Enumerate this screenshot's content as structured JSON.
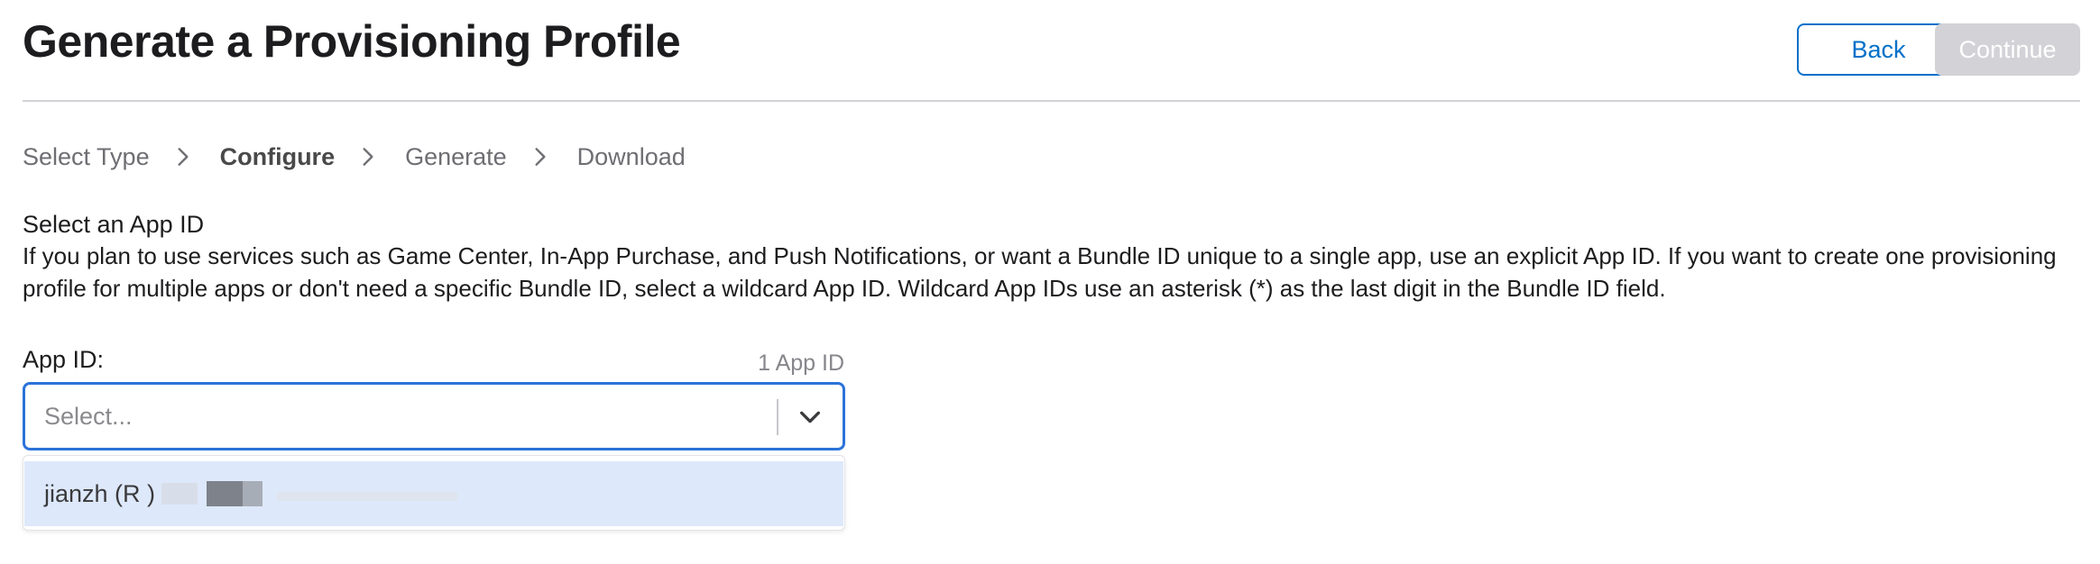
{
  "header": {
    "title": "Generate a Provisioning Profile",
    "back_label": "Back",
    "continue_label": "Continue"
  },
  "breadcrumb": {
    "steps": [
      {
        "label": "Select Type",
        "current": false
      },
      {
        "label": "Configure",
        "current": true
      },
      {
        "label": "Generate",
        "current": false
      },
      {
        "label": "Download",
        "current": false
      }
    ]
  },
  "section": {
    "title": "Select an App ID",
    "description": "If you plan to use services such as Game Center, In-App Purchase, and Push Notifications, or want a Bundle ID unique to a single app, use an explicit App ID. If you want to create one provisioning profile for multiple apps or don't need a specific Bundle ID, select a wildcard App ID. Wildcard App IDs use an asterisk (*) as the last digit in the Bundle ID field."
  },
  "app_id_field": {
    "label": "App ID:",
    "count": "1 App ID",
    "placeholder": "Select...",
    "options": [
      {
        "label": "jianzh (R                                                                               )"
      }
    ]
  },
  "colors": {
    "accent": "#0070c9",
    "focus_border": "#2b73d9",
    "disabled_button": "#d2d2d7",
    "option_highlight": "#dde8fa"
  },
  "icons": {
    "breadcrumb_separator": "chevron-right-icon",
    "select_toggle": "chevron-down-icon"
  }
}
